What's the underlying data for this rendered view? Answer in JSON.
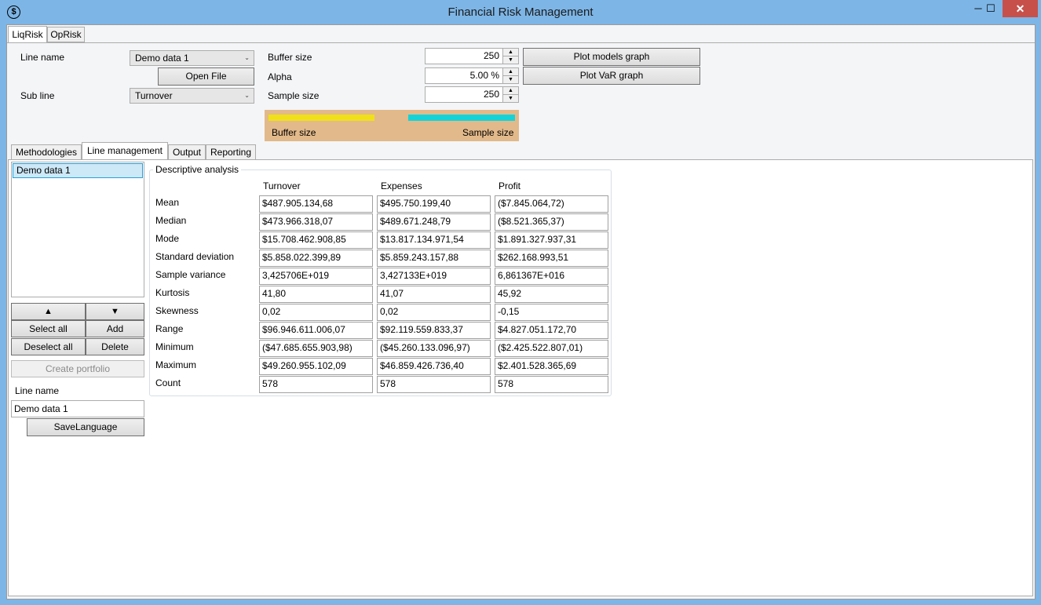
{
  "window": {
    "title": "Financial Risk Management",
    "minimize": "─",
    "maximize": "☐",
    "close": "✕",
    "app_icon": "$"
  },
  "top_tabs": [
    "LiqRisk",
    "OpRisk"
  ],
  "params": {
    "line_name_label": "Line name",
    "line_name_value": "Demo data 1",
    "open_file": "Open File",
    "sub_line_label": "Sub line",
    "sub_line_value": "Turnover",
    "buffer_size_label": "Buffer size",
    "buffer_size_value": "250",
    "alpha_label": "Alpha",
    "alpha_value": "5.00 %",
    "sample_size_label": "Sample size",
    "sample_size_value": "250",
    "plot_models": "Plot models graph",
    "plot_var": "Plot VaR graph",
    "bar_buffer_label": "Buffer size",
    "bar_sample_label": "Sample size",
    "colors": {
      "buffer": "#f0e01a",
      "sample": "#14d3d8",
      "bar_bg": "#e2b98a"
    }
  },
  "sub_tabs": [
    "Methodologies",
    "Line management",
    "Output",
    "Reporting"
  ],
  "sidebar": {
    "list_items": [
      "Demo data 1"
    ],
    "up": "▲",
    "down": "▼",
    "select_all": "Select all",
    "add": "Add",
    "deselect_all": "Deselect all",
    "delete": "Delete",
    "create_portfolio": "Create portfolio",
    "line_name_label": "Line name",
    "line_name_value": "Demo data 1",
    "save_language": "SaveLanguage"
  },
  "analysis": {
    "group_title": "Descriptive analysis",
    "columns": [
      "Turnover",
      "Expenses",
      "Profit"
    ],
    "rows": [
      {
        "label": "Mean",
        "values": [
          "$487.905.134,68",
          "$495.750.199,40",
          "($7.845.064,72)"
        ]
      },
      {
        "label": "Median",
        "values": [
          "$473.966.318,07",
          "$489.671.248,79",
          "($8.521.365,37)"
        ]
      },
      {
        "label": "Mode",
        "values": [
          "$15.708.462.908,85",
          "$13.817.134.971,54",
          "$1.891.327.937,31"
        ]
      },
      {
        "label": "Standard deviation",
        "values": [
          "$5.858.022.399,89",
          "$5.859.243.157,88",
          "$262.168.993,51"
        ]
      },
      {
        "label": "Sample variance",
        "values": [
          "3,425706E+019",
          "3,427133E+019",
          "6,861367E+016"
        ]
      },
      {
        "label": "Kurtosis",
        "values": [
          "41,80",
          "41,07",
          "45,92"
        ]
      },
      {
        "label": "Skewness",
        "values": [
          "0,02",
          "0,02",
          "-0,15"
        ]
      },
      {
        "label": "Range",
        "values": [
          "$96.946.611.006,07",
          "$92.119.559.833,37",
          "$4.827.051.172,70"
        ]
      },
      {
        "label": "Minimum",
        "values": [
          "($47.685.655.903,98)",
          "($45.260.133.096,97)",
          "($2.425.522.807,01)"
        ]
      },
      {
        "label": "Maximum",
        "values": [
          "$49.260.955.102,09",
          "$46.859.426.736,40",
          "$2.401.528.365,69"
        ]
      },
      {
        "label": "Count",
        "values": [
          "578",
          "578",
          "578"
        ]
      }
    ]
  }
}
